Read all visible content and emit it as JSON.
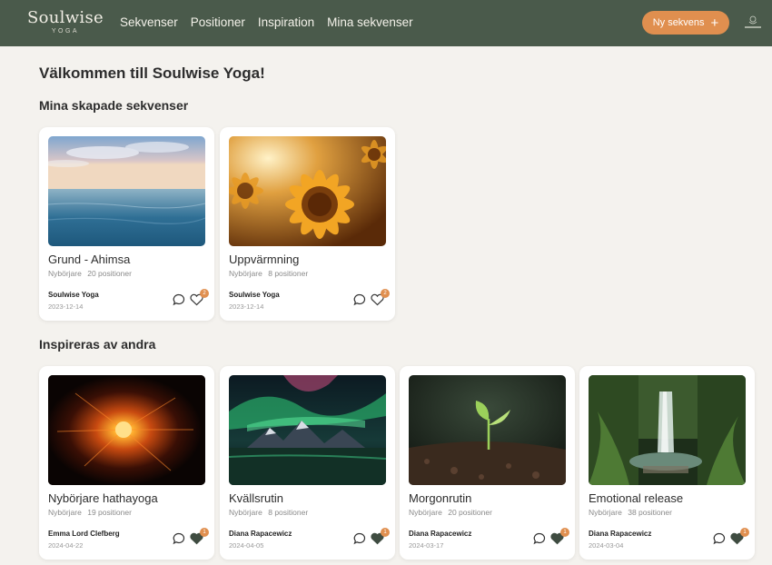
{
  "header": {
    "logo": "Soulwise",
    "logo_sub": "YOGA",
    "nav": [
      "Sekvenser",
      "Positioner",
      "Inspiration",
      "Mina sekvenser"
    ],
    "new_button": "Ny sekvens",
    "accent": "#e08f4f",
    "bar_color": "#4a5a4b"
  },
  "welcome": "Välkommen till Soulwise Yoga!",
  "my_section": {
    "title": "Mina skapade sekvenser",
    "cards": [
      {
        "title": "Grund - Ahimsa",
        "level": "Nybörjare",
        "positions": "20 positioner",
        "author": "Soulwise Yoga",
        "date": "2023-12-14",
        "likes": "2",
        "liked": false,
        "image": "ocean"
      },
      {
        "title": "Uppvärmning",
        "level": "Nybörjare",
        "positions": "8 positioner",
        "author": "Soulwise Yoga",
        "date": "2023-12-14",
        "likes": "2",
        "liked": false,
        "image": "sunflower"
      }
    ]
  },
  "inspire_section": {
    "title": "Inspireras av andra",
    "cards": [
      {
        "title": "Nybörjare hathayoga",
        "level": "Nybörjare",
        "positions": "19 positioner",
        "author": "Emma Lord Clefberg",
        "date": "2024-04-22",
        "likes": "1",
        "liked": true,
        "image": "sun-explosion"
      },
      {
        "title": "Kvällsrutin",
        "level": "Nybörjare",
        "positions": "8 positioner",
        "author": "Diana Rapacewicz",
        "date": "2024-04-05",
        "likes": "1",
        "liked": true,
        "image": "aurora"
      },
      {
        "title": "Morgonrutin",
        "level": "Nybörjare",
        "positions": "20 positioner",
        "author": "Diana Rapacewicz",
        "date": "2024-03-17",
        "likes": "1",
        "liked": true,
        "image": "sprout"
      },
      {
        "title": "Emotional release",
        "level": "Nybörjare",
        "positions": "38 positioner",
        "author": "Diana Rapacewicz",
        "date": "2024-03-04",
        "likes": "1",
        "liked": true,
        "image": "waterfall"
      }
    ]
  }
}
